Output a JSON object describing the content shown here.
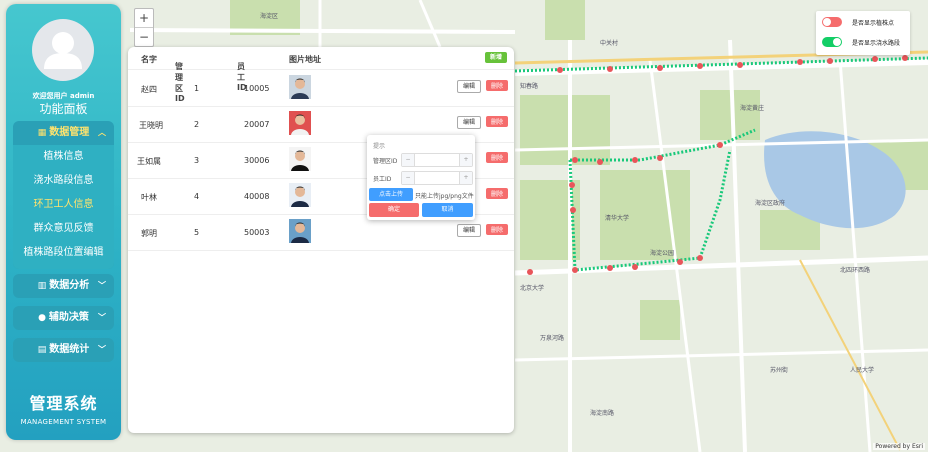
{
  "app": {
    "brand": "管理系统",
    "brand_sub": "MANAGEMENT SYSTEM"
  },
  "sidebar": {
    "welcome": "欢迎您用户 admin",
    "panel_title": "功能面板",
    "groups": [
      {
        "label": "数据管理",
        "icon": "grid-icon",
        "expanded": true,
        "items": [
          "植株信息",
          "浇水路段信息",
          "环卫工人信息",
          "群众意见反馈",
          "植株路段位置编辑"
        ],
        "active": "环卫工人信息"
      },
      {
        "label": "数据分析",
        "icon": "bar-chart-icon",
        "expanded": false
      },
      {
        "label": "辅助决策",
        "icon": "user-icon",
        "expanded": false
      },
      {
        "label": "数据统计",
        "icon": "document-icon",
        "expanded": false
      }
    ]
  },
  "table": {
    "headers": {
      "name": "名字",
      "area_id": "管理区ID",
      "staff_id": "员工ID",
      "photo": "图片地址"
    },
    "add_label": "新增",
    "edit_label": "编辑",
    "delete_label": "删除",
    "rows": [
      {
        "name": "赵四",
        "area_id": "1",
        "staff_id": "10005"
      },
      {
        "name": "王晓明",
        "area_id": "2",
        "staff_id": "20007"
      },
      {
        "name": "王如属",
        "area_id": "3",
        "staff_id": "30006"
      },
      {
        "name": "叶林",
        "area_id": "4",
        "staff_id": "40008"
      },
      {
        "name": "郭明",
        "area_id": "5",
        "staff_id": "50003"
      }
    ]
  },
  "dialog": {
    "title": "提示",
    "area_label": "管理区ID",
    "staff_label": "员工ID",
    "minus": "−",
    "plus": "+",
    "upload_label": "点击上传",
    "upload_hint": "只能上传jpg/png文件",
    "ok_label": "确定",
    "cancel_label": "取消"
  },
  "toggles": [
    {
      "label": "是否显示植株点",
      "on": false,
      "color": "#f56c6c"
    },
    {
      "label": "是否显示浇水路段",
      "on": true,
      "color": "#13ce66"
    }
  ],
  "map": {
    "attribution": "Powered by Esri",
    "labels": {
      "l1": "海淀区",
      "l2": "中关村",
      "l3": "北京大学",
      "l4": "清华大学",
      "l5": "海淀公园",
      "l6": "海淀黄庄",
      "l7": "知春路",
      "l8": "海淀区政府",
      "l9": "北四环西路",
      "l10": "苏州街",
      "l11": "万泉河路",
      "l12": "人民大学",
      "l13": "海淀南路"
    },
    "zoom_in": "+",
    "zoom_out": "−"
  }
}
